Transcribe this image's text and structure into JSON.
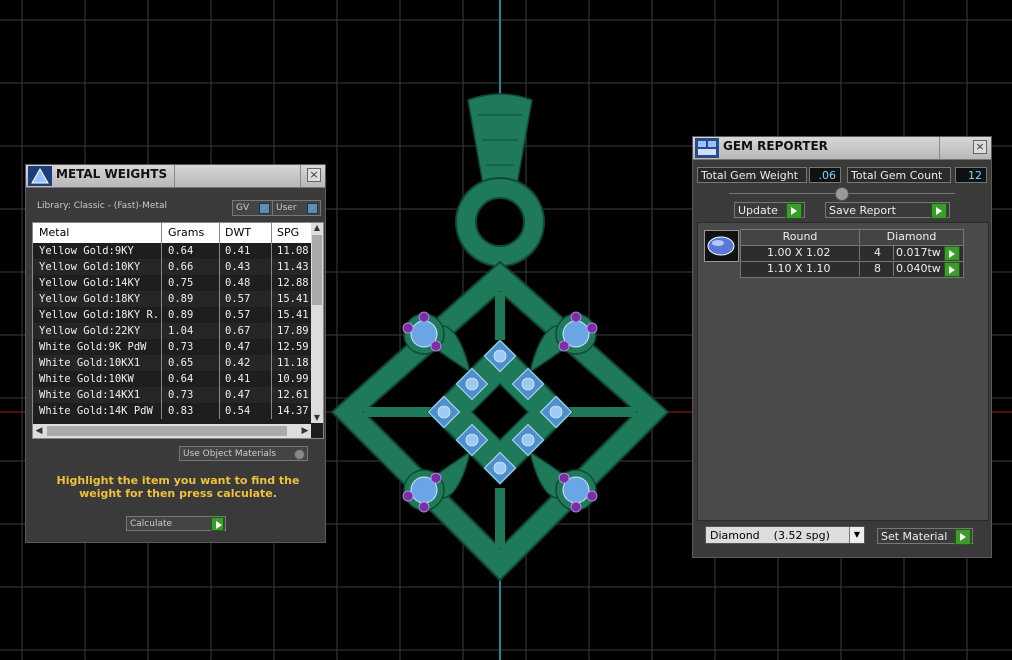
{
  "colors": {
    "background": "#000000",
    "grid": "#3c3c3c",
    "axis_vertical": "#1a8a94",
    "axis_horizontal": "#a11a1a",
    "pendant_metal": "#1f7a5a",
    "gem_blue": "#6aa6e6",
    "prong_purple": "#7a2fa8",
    "value_text": "#7fd3ff",
    "hint_text": "#f0c23a"
  },
  "metal_weights": {
    "title": "METAL WEIGHTS",
    "library_label": "Library: Classic - (Fast)-Metal",
    "gv_label": "GV",
    "user_label": "User",
    "columns": [
      "Metal",
      "Grams",
      "DWT",
      "SPG"
    ],
    "rows": [
      [
        "Yellow Gold:9KY",
        "0.64",
        "0.41",
        "11.08"
      ],
      [
        "Yellow Gold:10KY",
        "0.66",
        "0.43",
        "11.43"
      ],
      [
        "Yellow Gold:14KY",
        "0.75",
        "0.48",
        "12.88"
      ],
      [
        "Yellow Gold:18KY",
        "0.89",
        "0.57",
        "15.41"
      ],
      [
        "Yellow Gold:18KY R...",
        "0.89",
        "0.57",
        "15.41"
      ],
      [
        "Yellow Gold:22KY",
        "1.04",
        "0.67",
        "17.89"
      ],
      [
        "White Gold:9K PdW",
        "0.73",
        "0.47",
        "12.59"
      ],
      [
        "White Gold:10KX1",
        "0.65",
        "0.42",
        "11.18"
      ],
      [
        "White Gold:10KW",
        "0.64",
        "0.41",
        "10.99"
      ],
      [
        "White Gold:14KX1",
        "0.73",
        "0.47",
        "12.61"
      ],
      [
        "White Gold:14K PdW",
        "0.83",
        "0.54",
        "14.37"
      ]
    ],
    "use_object_materials": "Use Object Materials",
    "hint": "Highlight the item you want to find the weight for then press calculate.",
    "calculate": "Calculate"
  },
  "gem_reporter": {
    "title": "GEM REPORTER",
    "total_weight_label": "Total Gem Weight",
    "total_weight_value": ".06",
    "total_count_label": "Total Gem Count",
    "total_count_value": "12",
    "update_label": "Update",
    "save_report_label": "Save Report",
    "header_shape": "Round",
    "header_material": "Diamond",
    "rows": [
      {
        "size": "1.00 X 1.02",
        "count": "4",
        "weight": "0.017tw"
      },
      {
        "size": "1.10 X 1.10",
        "count": "8",
        "weight": "0.040tw"
      }
    ],
    "material_select": "Diamond    (3.52 spg)",
    "set_material": "Set Material"
  }
}
